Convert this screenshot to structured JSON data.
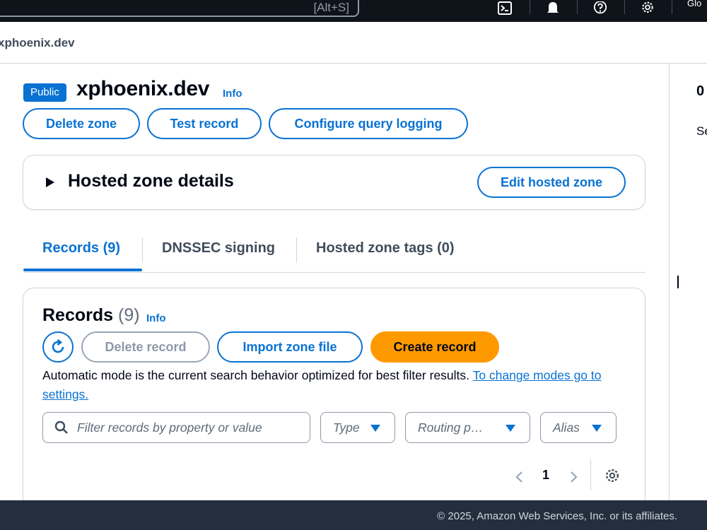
{
  "topnav": {
    "search_shortcut": "[Alt+S]",
    "icons": [
      "cloudshell-icon",
      "notifications-icon",
      "help-icon",
      "settings-icon"
    ],
    "region_label": "Glo"
  },
  "breadcrumb": {
    "current": "xphoenix.dev"
  },
  "side_panel": {
    "line1": "0",
    "line2": "Se"
  },
  "zone": {
    "badge": "Public",
    "title": "xphoenix.dev",
    "info_label": "Info",
    "buttons": {
      "delete_zone": "Delete zone",
      "test_record": "Test record",
      "configure_logging": "Configure query logging"
    }
  },
  "details": {
    "title": "Hosted zone details",
    "edit_button": "Edit hosted zone"
  },
  "tabs": [
    {
      "label": "Records (9)",
      "active": true
    },
    {
      "label": "DNSSEC signing",
      "active": false
    },
    {
      "label": "Hosted zone tags (0)",
      "active": false
    }
  ],
  "records": {
    "title": "Records",
    "count": "(9)",
    "info_label": "Info",
    "delete_button": "Delete record",
    "import_button": "Import zone file",
    "create_button": "Create record",
    "mode_text": "Automatic mode is the current search behavior optimized for best filter results.",
    "mode_link": "To change modes go to settings.",
    "filter_placeholder": "Filter records by property or value",
    "filters": [
      "Type",
      "Routing p…",
      "Alias"
    ],
    "page_number": "1"
  },
  "footer": {
    "copyright": "© 2025, Amazon Web Services, Inc. or its affiliates."
  },
  "colors": {
    "accent": "#0972d3",
    "primary": "#ff9900",
    "nav_bg": "#0f141a",
    "footer_bg": "#232f3e"
  }
}
